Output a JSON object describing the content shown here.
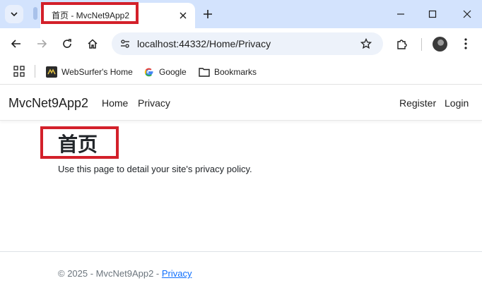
{
  "browser": {
    "tab_title": "首页 - MvcNet9App2",
    "url": "localhost:44332/Home/Privacy",
    "bookmarks": [
      {
        "label": "WebSurfer's Home",
        "icon": "websurfer-favicon-icon"
      },
      {
        "label": "Google",
        "icon": "google-g-icon"
      },
      {
        "label": "Bookmarks",
        "icon": "folder-icon"
      }
    ]
  },
  "site": {
    "brand": "MvcNet9App2",
    "nav": {
      "home": "Home",
      "privacy": "Privacy",
      "register": "Register",
      "login": "Login"
    }
  },
  "page": {
    "heading": "首页",
    "body": "Use this page to detail your site's privacy policy."
  },
  "footer": {
    "copyright": "© 2025 - MvcNet9App2 - ",
    "link": "Privacy"
  },
  "colors": {
    "highlight_box": "#d3202a",
    "tabstrip": "#d3e3fd",
    "link": "#0d6efd"
  }
}
